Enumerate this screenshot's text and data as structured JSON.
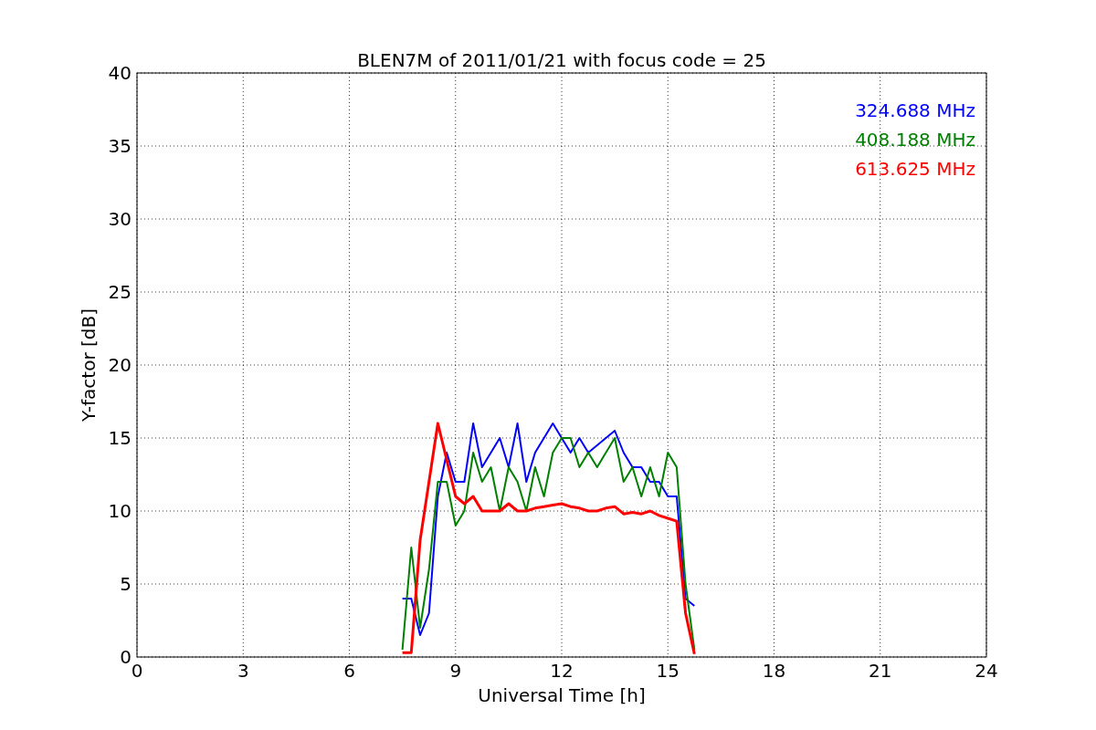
{
  "chart_data": {
    "type": "line",
    "title": "BLEN7M of 2011/01/21 with focus code = 25",
    "xlabel": "Universal Time [h]",
    "ylabel": "Y-factor [dB]",
    "xlim": [
      0,
      24
    ],
    "ylim": [
      0,
      40
    ],
    "xticks": [
      0,
      3,
      6,
      9,
      12,
      15,
      18,
      21,
      24
    ],
    "yticks": [
      0,
      5,
      10,
      15,
      20,
      25,
      30,
      35,
      40
    ],
    "grid": true,
    "x": [
      7.5,
      7.75,
      8.0,
      8.25,
      8.5,
      8.75,
      9.0,
      9.25,
      9.5,
      9.75,
      10,
      10.25,
      10.5,
      10.75,
      11,
      11.25,
      11.5,
      11.75,
      12,
      12.25,
      12.5,
      12.75,
      13,
      13.25,
      13.5,
      13.75,
      14,
      14.25,
      14.5,
      14.75,
      15,
      15.25,
      15.5,
      15.75
    ],
    "series": [
      {
        "name": "324.688 MHz",
        "color": "#0000ff",
        "values": [
          4,
          4,
          1.5,
          3,
          11,
          14,
          12,
          12,
          16,
          13,
          14,
          15,
          13,
          16,
          12,
          14,
          15,
          16,
          15,
          14,
          15,
          14,
          14.5,
          15,
          15.5,
          14,
          13,
          13,
          12,
          12,
          11,
          11,
          4,
          3.5
        ]
      },
      {
        "name": "408.188 MHz",
        "color": "#008000",
        "values": [
          0.5,
          7.5,
          2,
          6,
          12,
          12,
          9,
          10,
          14,
          12,
          13,
          10,
          13,
          12,
          10,
          13,
          11,
          14,
          15,
          15,
          13,
          14,
          13,
          14,
          15,
          12,
          13,
          11,
          13,
          11,
          14,
          13,
          5,
          0.5
        ]
      },
      {
        "name": "613.625 MHz",
        "color": "#ff0000",
        "values": [
          0.3,
          0.3,
          8,
          12,
          16,
          13.5,
          11,
          10.5,
          11,
          10,
          10,
          10,
          10.5,
          10,
          10,
          10.2,
          10.3,
          10.4,
          10.5,
          10.3,
          10.2,
          10,
          10,
          10.2,
          10.3,
          9.8,
          9.9,
          9.8,
          10,
          9.7,
          9.5,
          9.3,
          3,
          0.2
        ]
      }
    ]
  }
}
